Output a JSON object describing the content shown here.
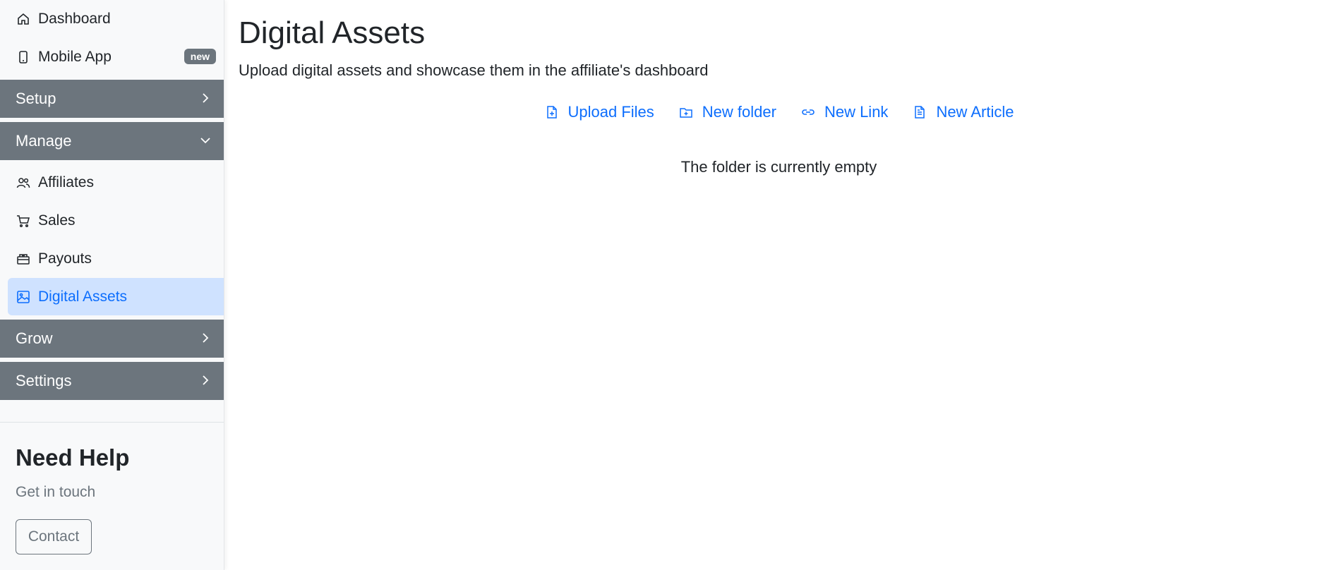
{
  "sidebar": {
    "top_items": [
      {
        "label": "Dashboard",
        "icon": "house-icon"
      },
      {
        "label": "Mobile App",
        "icon": "phone-icon",
        "badge": "new"
      }
    ],
    "sections": {
      "setup": "Setup",
      "manage": "Manage",
      "grow": "Grow",
      "settings": "Settings"
    },
    "manage_items": [
      {
        "label": "Affiliates",
        "icon": "people-icon"
      },
      {
        "label": "Sales",
        "icon": "cart-icon"
      },
      {
        "label": "Payouts",
        "icon": "cash-icon"
      },
      {
        "label": "Digital Assets",
        "icon": "image-icon",
        "active": true
      }
    ],
    "help": {
      "title": "Need Help",
      "subtitle": "Get in touch",
      "contact_label": "Contact"
    }
  },
  "main": {
    "title": "Digital Assets",
    "description": "Upload digital assets and showcase them in the affiliate's dashboard",
    "actions": [
      {
        "label": "Upload Files",
        "icon": "file-plus-icon"
      },
      {
        "label": "New folder",
        "icon": "folder-plus-icon"
      },
      {
        "label": "New Link",
        "icon": "link-icon"
      },
      {
        "label": "New Article",
        "icon": "file-text-icon"
      }
    ],
    "empty_message": "The folder is currently empty"
  },
  "colors": {
    "accent": "#0d6efd",
    "active_bg": "#cfe2ff",
    "section_bg": "#6c757d",
    "sidebar_bg": "#f8f9fa"
  }
}
